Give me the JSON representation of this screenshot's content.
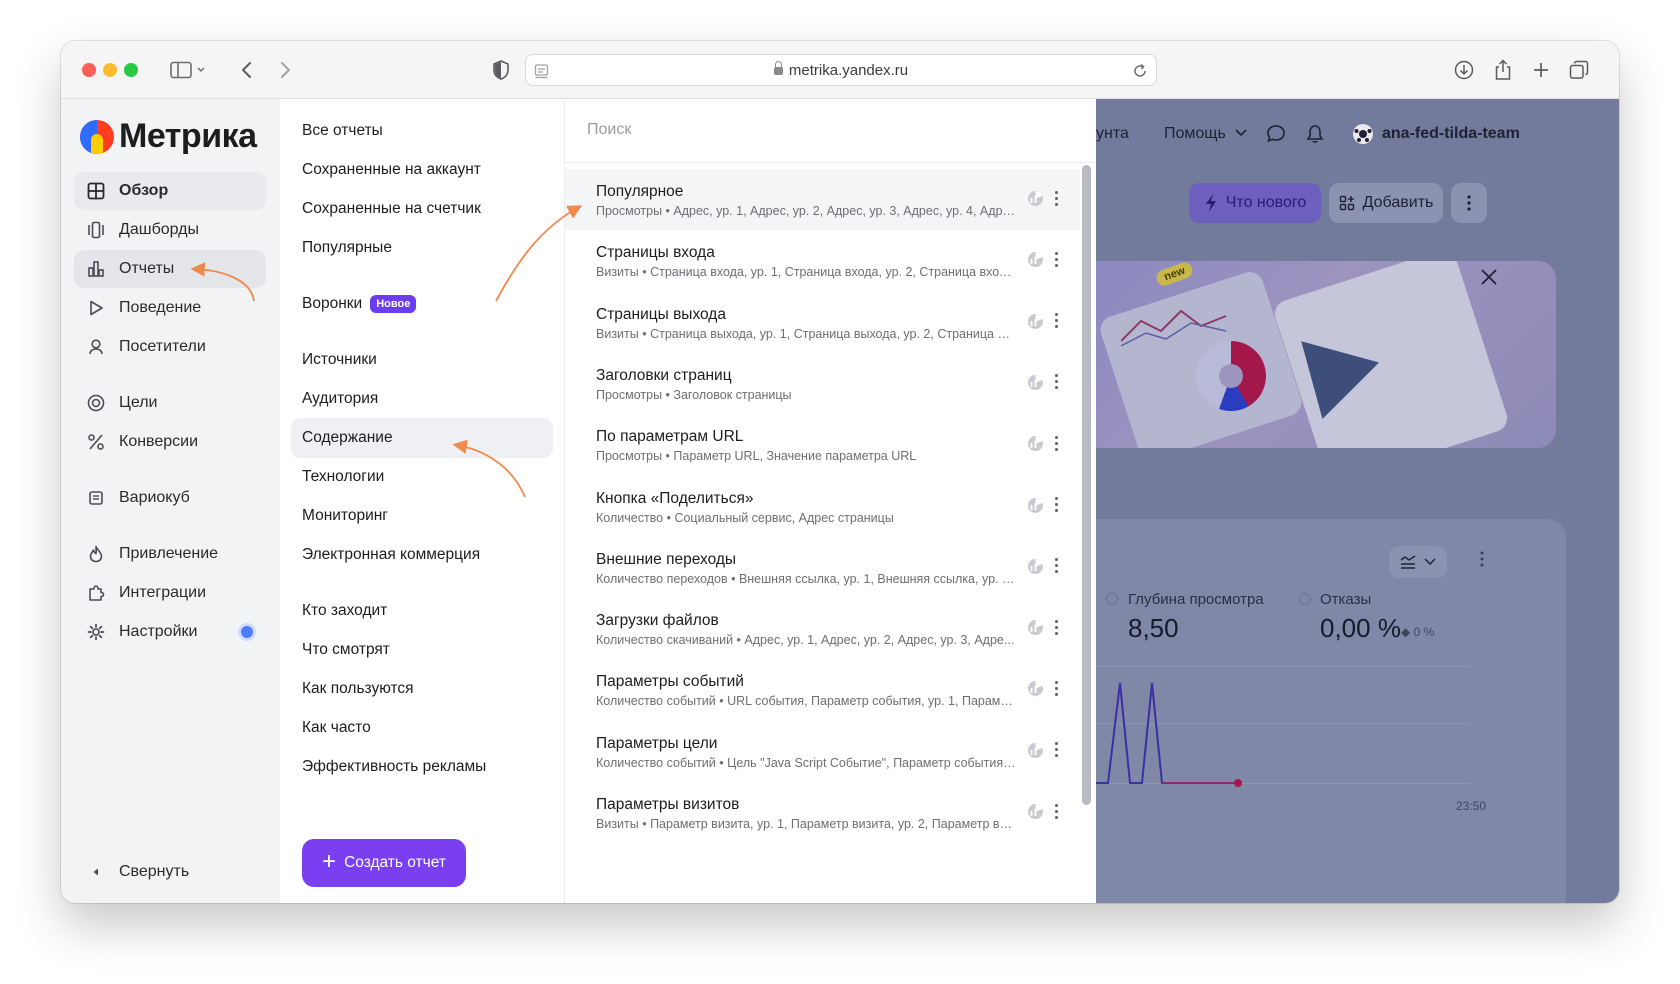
{
  "browser": {
    "url": "metrika.yandex.ru"
  },
  "sidebar": {
    "logo_text": "Метрика",
    "items": [
      {
        "label": "Обзор",
        "icon": "grid-icon"
      },
      {
        "label": "Дашборды",
        "icon": "dashboards-icon"
      },
      {
        "label": "Отчеты",
        "icon": "bar-chart-icon"
      },
      {
        "label": "Поведение",
        "icon": "play-icon"
      },
      {
        "label": "Посетители",
        "icon": "user-icon"
      },
      {
        "label": "Цели",
        "icon": "target-icon"
      },
      {
        "label": "Конверсии",
        "icon": "percent-icon"
      },
      {
        "label": "Вариокуб",
        "icon": "cube-icon"
      },
      {
        "label": "Привлечение",
        "icon": "flame-icon"
      },
      {
        "label": "Интеграции",
        "icon": "puzzle-icon"
      },
      {
        "label": "Настройки",
        "icon": "gear-icon"
      }
    ],
    "collapse_label": "Свернуть"
  },
  "reports_menu": {
    "items": [
      "Все отчеты",
      "Сохраненные на аккаунт",
      "Сохраненные на счетчик",
      "Популярные",
      "Воронки",
      "Источники",
      "Аудитория",
      "Содержание",
      "Технологии",
      "Мониторинг",
      "Электронная коммерция",
      "Кто заходит",
      "Что смотрят",
      "Как пользуются",
      "Как часто",
      "Эффективность рекламы"
    ],
    "new_badge": "Новое",
    "create_button": "Создать отчет",
    "create_plus": "+"
  },
  "report_list": {
    "search_placeholder": "Поиск",
    "items": [
      {
        "title": "Популярное",
        "subtitle": "Просмотры • Адрес, ур. 1, Адрес, ур. 2, Адрес, ур. 3, Адрес, ур. 4, Адре..."
      },
      {
        "title": "Страницы входа",
        "subtitle": "Визиты • Страница входа, ур. 1, Страница входа, ур. 2, Страница входа..."
      },
      {
        "title": "Страницы выхода",
        "subtitle": "Визиты • Страница выхода, ур. 1, Страница выхода, ур. 2, Страница вы..."
      },
      {
        "title": "Заголовки страниц",
        "subtitle": "Просмотры • Заголовок страницы"
      },
      {
        "title": "По параметрам URL",
        "subtitle": "Просмотры • Параметр URL, Значение параметра URL"
      },
      {
        "title": "Кнопка «Поделиться»",
        "subtitle": "Количество • Социальный сервис, Адрес страницы"
      },
      {
        "title": "Внешние переходы",
        "subtitle": "Количество переходов • Внешняя ссылка, ур. 1, Внешняя ссылка, ур. 2, ..."
      },
      {
        "title": "Загрузки файлов",
        "subtitle": "Количество скачиваний • Адрес, ур. 1, Адрес, ур. 2, Адрес, ур. 3, Адре..."
      },
      {
        "title": "Параметры событий",
        "subtitle": "Количество событий • URL события, Параметр события, ур. 1, Параме..."
      },
      {
        "title": "Параметры цели",
        "subtitle": "Количество событий • Цель \"Java Script Событие\", Параметр события, ..."
      },
      {
        "title": "Параметры визитов",
        "subtitle": "Визиты • Параметр визита, ур. 1, Параметр визита, ур. 2, Параметр ви..."
      }
    ]
  },
  "background_page": {
    "account_fragment": "унта",
    "help_label": "Помощь",
    "username": "ana-fed-tilda-team",
    "whats_new": "Что нового",
    "add_label": "Добавить",
    "banner_new": "new",
    "metric_depth_label": "Глубина просмотра",
    "metric_depth_value": "8,50",
    "metric_bounce_label": "Отказы",
    "metric_bounce_value": "0,00 %",
    "metric_bounce_delta": "0 %",
    "time_label": "23:50"
  },
  "colors": {
    "accent": "#7b3ff2",
    "annotation_arrow": "#f08a4b",
    "badge": "#6c3cf0"
  }
}
